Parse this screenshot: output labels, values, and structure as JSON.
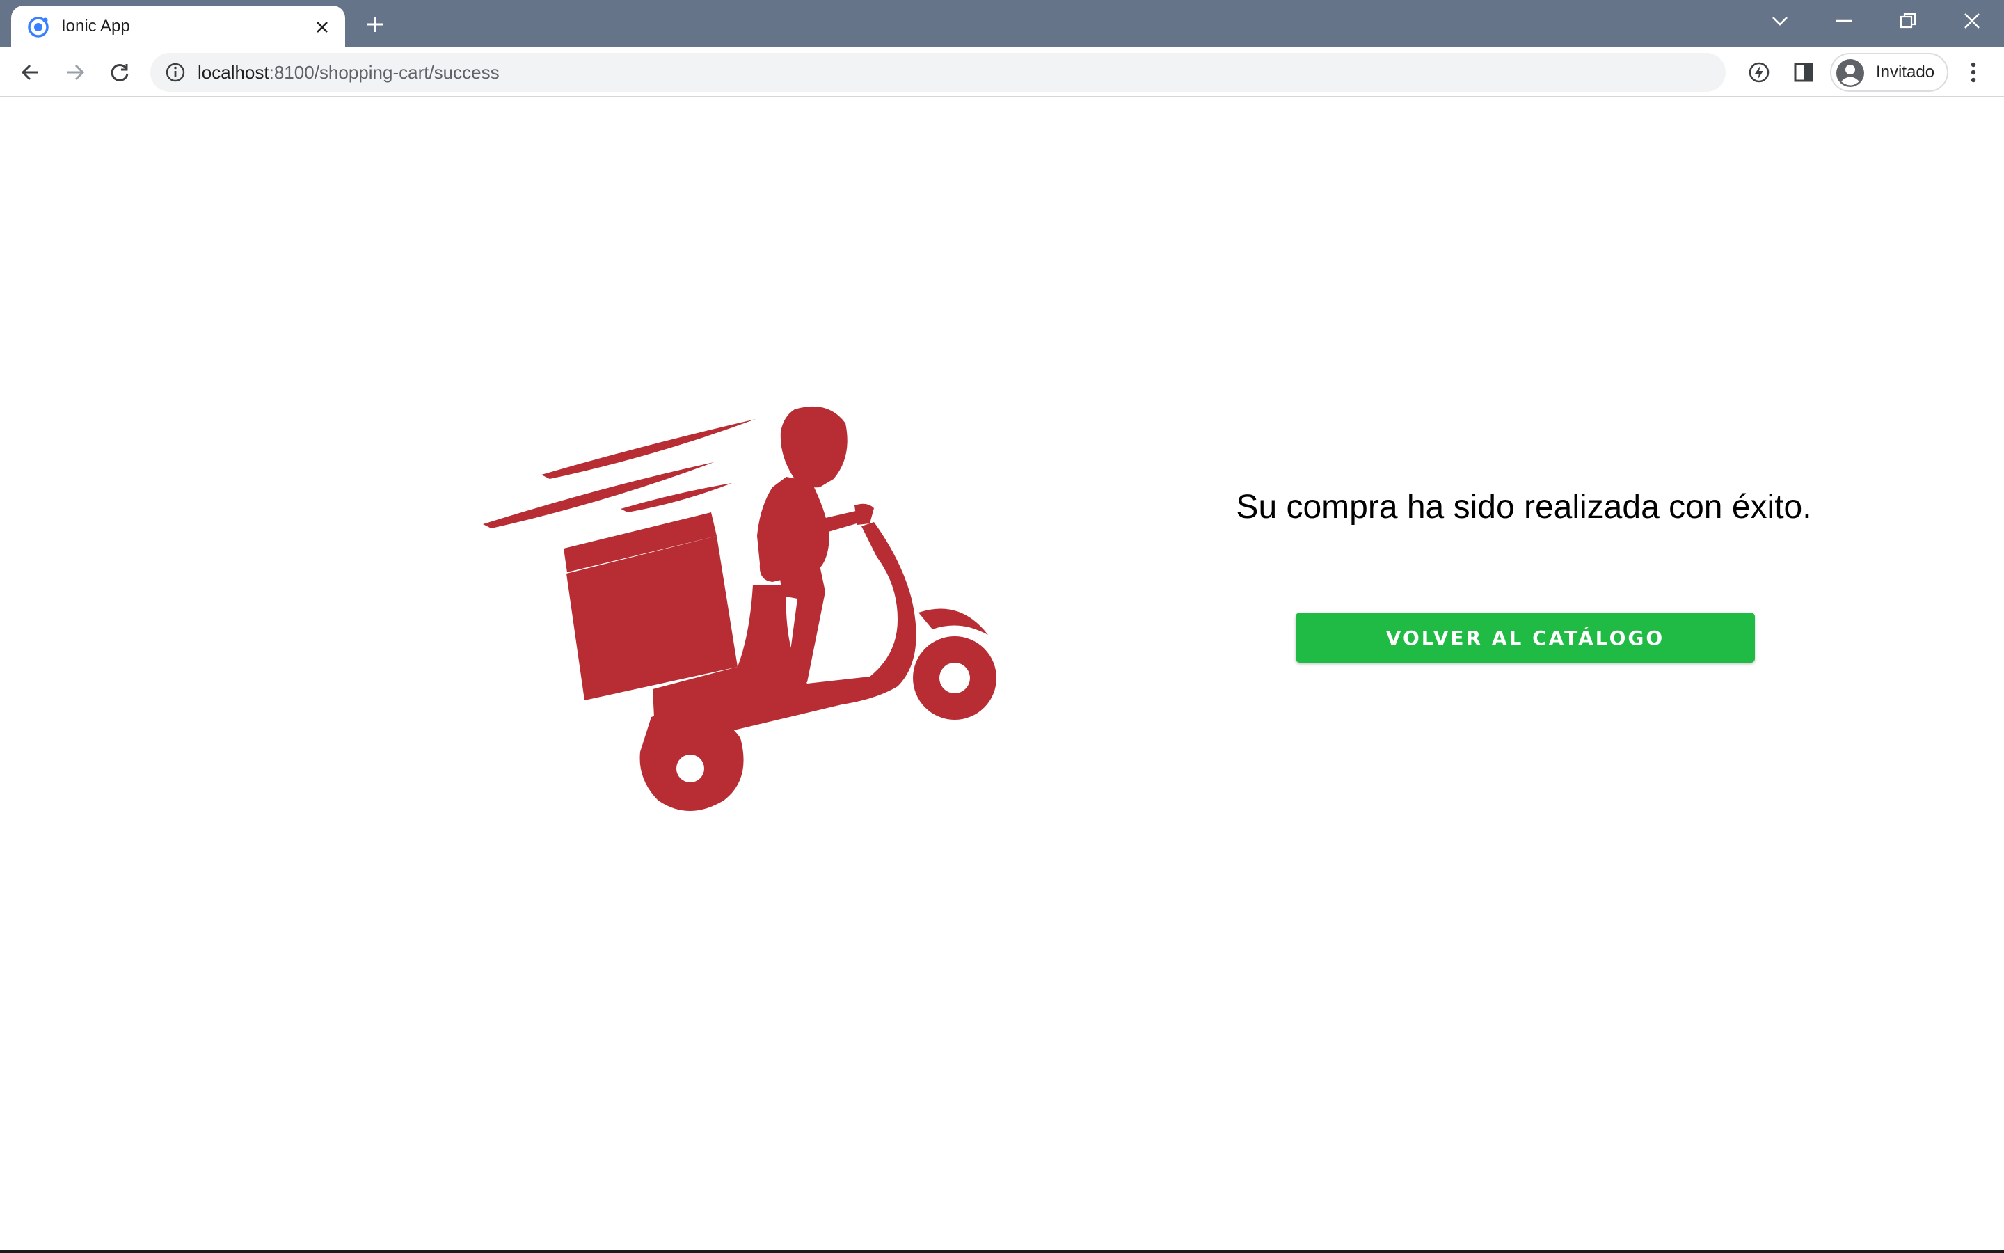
{
  "browser": {
    "tab_title": "Ionic App",
    "url_host": "localhost",
    "url_path": ":8100/shopping-cart/success",
    "profile_name": "Invitado"
  },
  "icons": {
    "favicon": "ionic-logo-icon",
    "tab_close": "close-icon",
    "new_tab": "plus-icon",
    "back": "arrow-left-icon",
    "forward": "arrow-right-icon",
    "reload": "reload-icon",
    "site_info": "info-icon",
    "translate": "translate-icon",
    "performance": "bolt-icon",
    "side_panel": "side-panel-icon",
    "profile": "avatar-icon",
    "menu": "kebab-menu-icon"
  },
  "main": {
    "message": "Su compra ha sido realizada con éxito.",
    "button_label": "VOLVER AL CATÁLOGO"
  },
  "colors": {
    "titlebar": "#667489",
    "accent_red": "#b72d33",
    "button_green": "#1fbb45"
  }
}
